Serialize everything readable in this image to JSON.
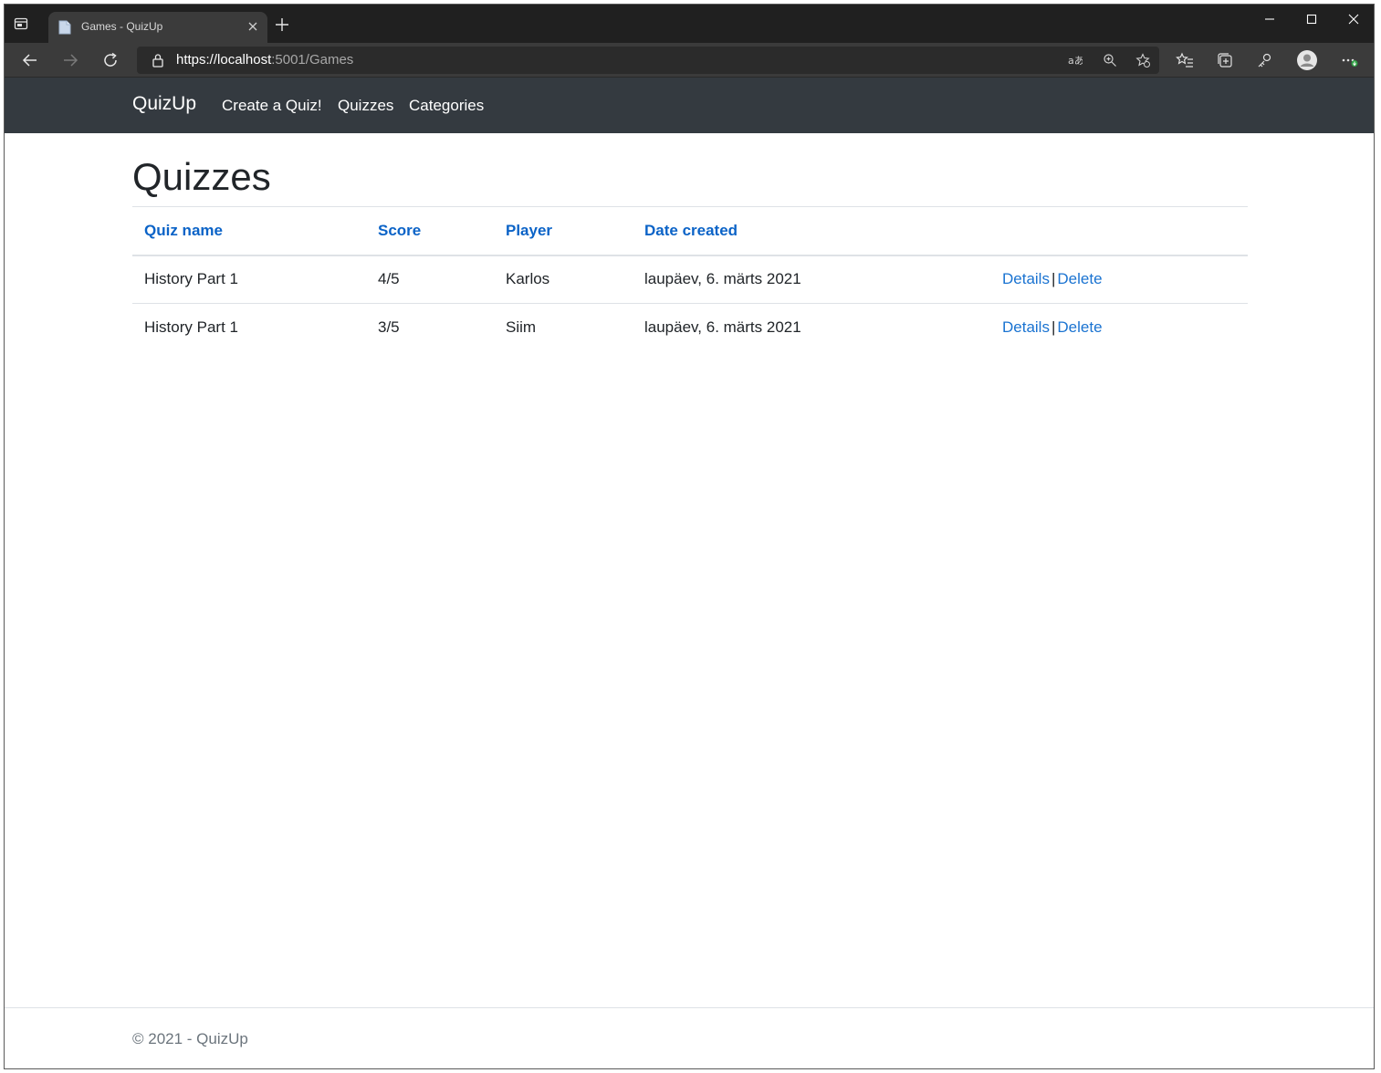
{
  "browser": {
    "tab_title": "Games - QuizUp",
    "url_scheme": "https://",
    "url_host": "localhost",
    "url_rest": ":5001/Games"
  },
  "navbar": {
    "brand": "QuizUp",
    "links": [
      "Create a Quiz!",
      "Quizzes",
      "Categories"
    ]
  },
  "page": {
    "title": "Quizzes",
    "columns": [
      "Quiz name",
      "Score",
      "Player",
      "Date created"
    ],
    "rows": [
      {
        "quiz_name": "History Part 1",
        "score": "4/5",
        "player": "Karlos",
        "date_created": "laupäev, 6. märts 2021",
        "details": "Details",
        "delete": "Delete"
      },
      {
        "quiz_name": "History Part 1",
        "score": "3/5",
        "player": "Siim",
        "date_created": "laupäev, 6. märts 2021",
        "details": "Details",
        "delete": "Delete"
      }
    ],
    "separator": "|"
  },
  "footer": {
    "text": "© 2021 - QuizUp"
  },
  "colors": {
    "navbar_bg": "#343a40",
    "link": "#1a73d1",
    "header_link": "#0b63c7",
    "browser_chrome": "#202020"
  }
}
